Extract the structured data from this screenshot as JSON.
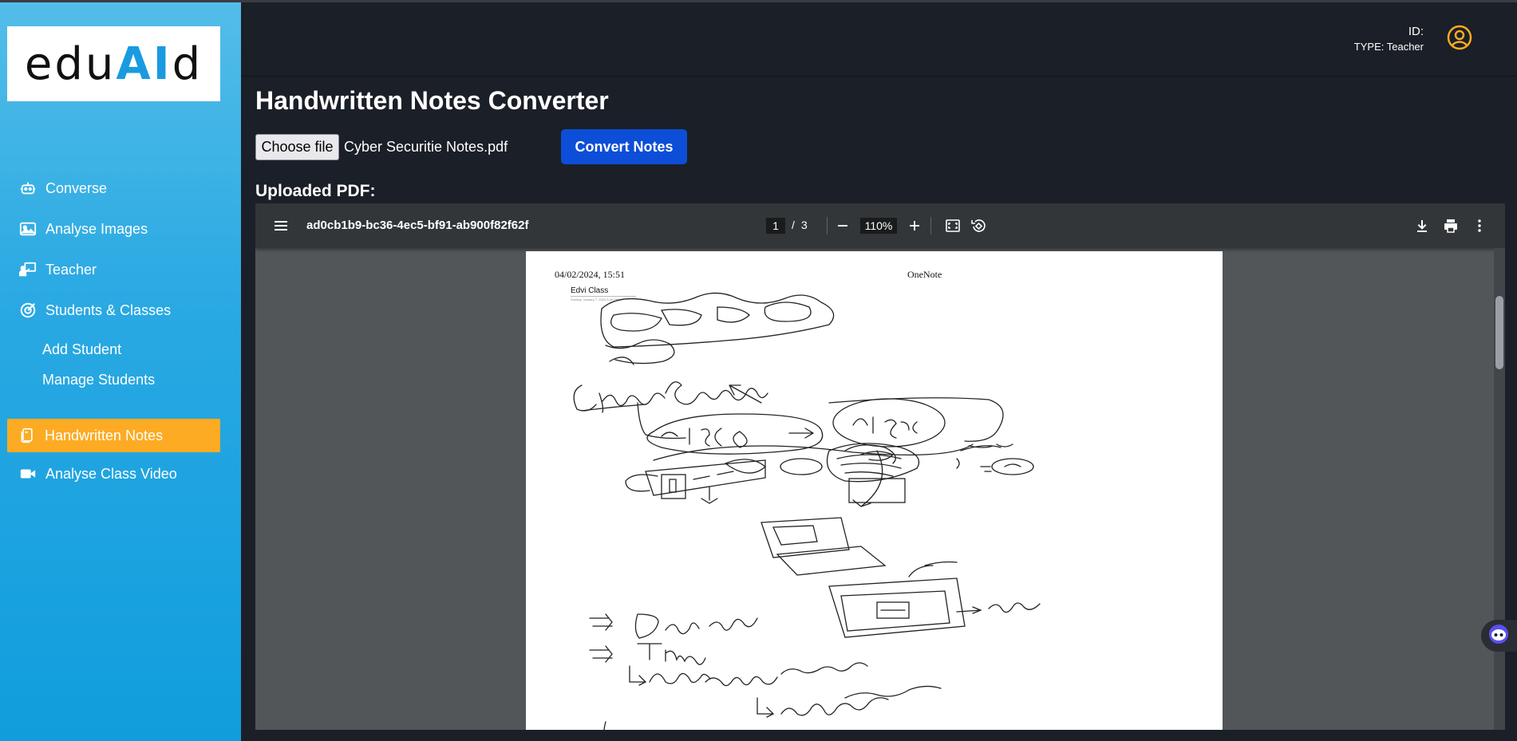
{
  "app": {
    "logo_prefix": "edu",
    "logo_accent": "AI",
    "logo_suffix": "d",
    "accent_color": "#fdab23",
    "brand_color": "#1a9be0"
  },
  "sidebar": {
    "items": [
      {
        "label": "Converse",
        "icon": "robot-icon"
      },
      {
        "label": "Analyse Images",
        "icon": "image-icon"
      },
      {
        "label": "Teacher",
        "icon": "teacher-board-icon"
      },
      {
        "label": "Students & Classes",
        "icon": "target-icon"
      }
    ],
    "sub_items": [
      {
        "label": "Add Student"
      },
      {
        "label": "Manage Students"
      }
    ],
    "active": {
      "label": "Handwritten Notes",
      "icon": "notes-icon"
    },
    "after": [
      {
        "label": "Analyse Class Video",
        "icon": "video-camera-icon"
      }
    ]
  },
  "header": {
    "user_id": "ID:",
    "user_type": "TYPE: Teacher",
    "avatar_icon": "user-circle-icon"
  },
  "main": {
    "title": "Handwritten Notes Converter",
    "choose_file_label": "Choose file",
    "file_name": "Cyber Securitie Notes.pdf",
    "convert_label": "Convert Notes",
    "uploaded_label": "Uploaded PDF:"
  },
  "pdf_viewer": {
    "doc_title": "ad0cb1b9-bc36-4ec5-bf91-ab900f82f62f",
    "current_page": "1",
    "page_sep": "/",
    "total_pages": "3",
    "zoom": "110%",
    "page_content": {
      "timestamp": "04/02/2024, 15:51",
      "app": "OneNote",
      "section": "Edvi Class",
      "section_sub": "Sunday, January 7, 2024    3:46 PM"
    }
  }
}
